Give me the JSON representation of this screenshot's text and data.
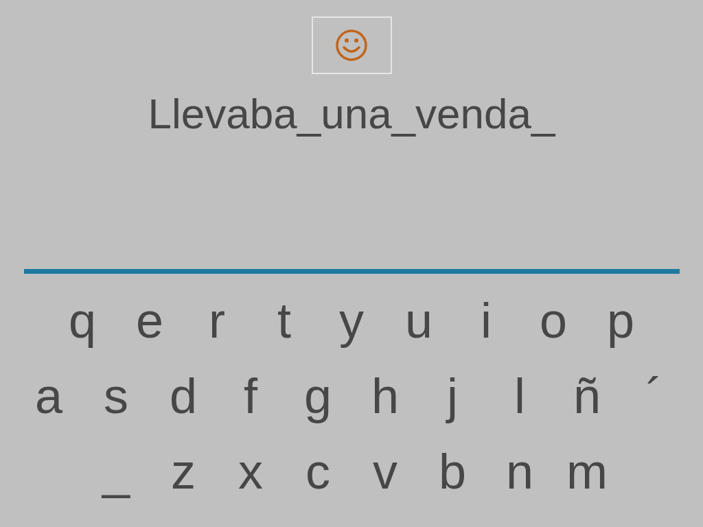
{
  "sentence": "Llevaba_una_venda_",
  "keyboard": {
    "rows": [
      [
        "q",
        "e",
        "r",
        "t",
        "y",
        "u",
        "i",
        "o",
        "p"
      ],
      [
        "a",
        "s",
        "d",
        "f",
        "g",
        "h",
        "j",
        "l",
        "ñ",
        "´"
      ],
      [
        "_",
        "z",
        "x",
        "c",
        "v",
        "b",
        "n",
        "m"
      ]
    ]
  }
}
